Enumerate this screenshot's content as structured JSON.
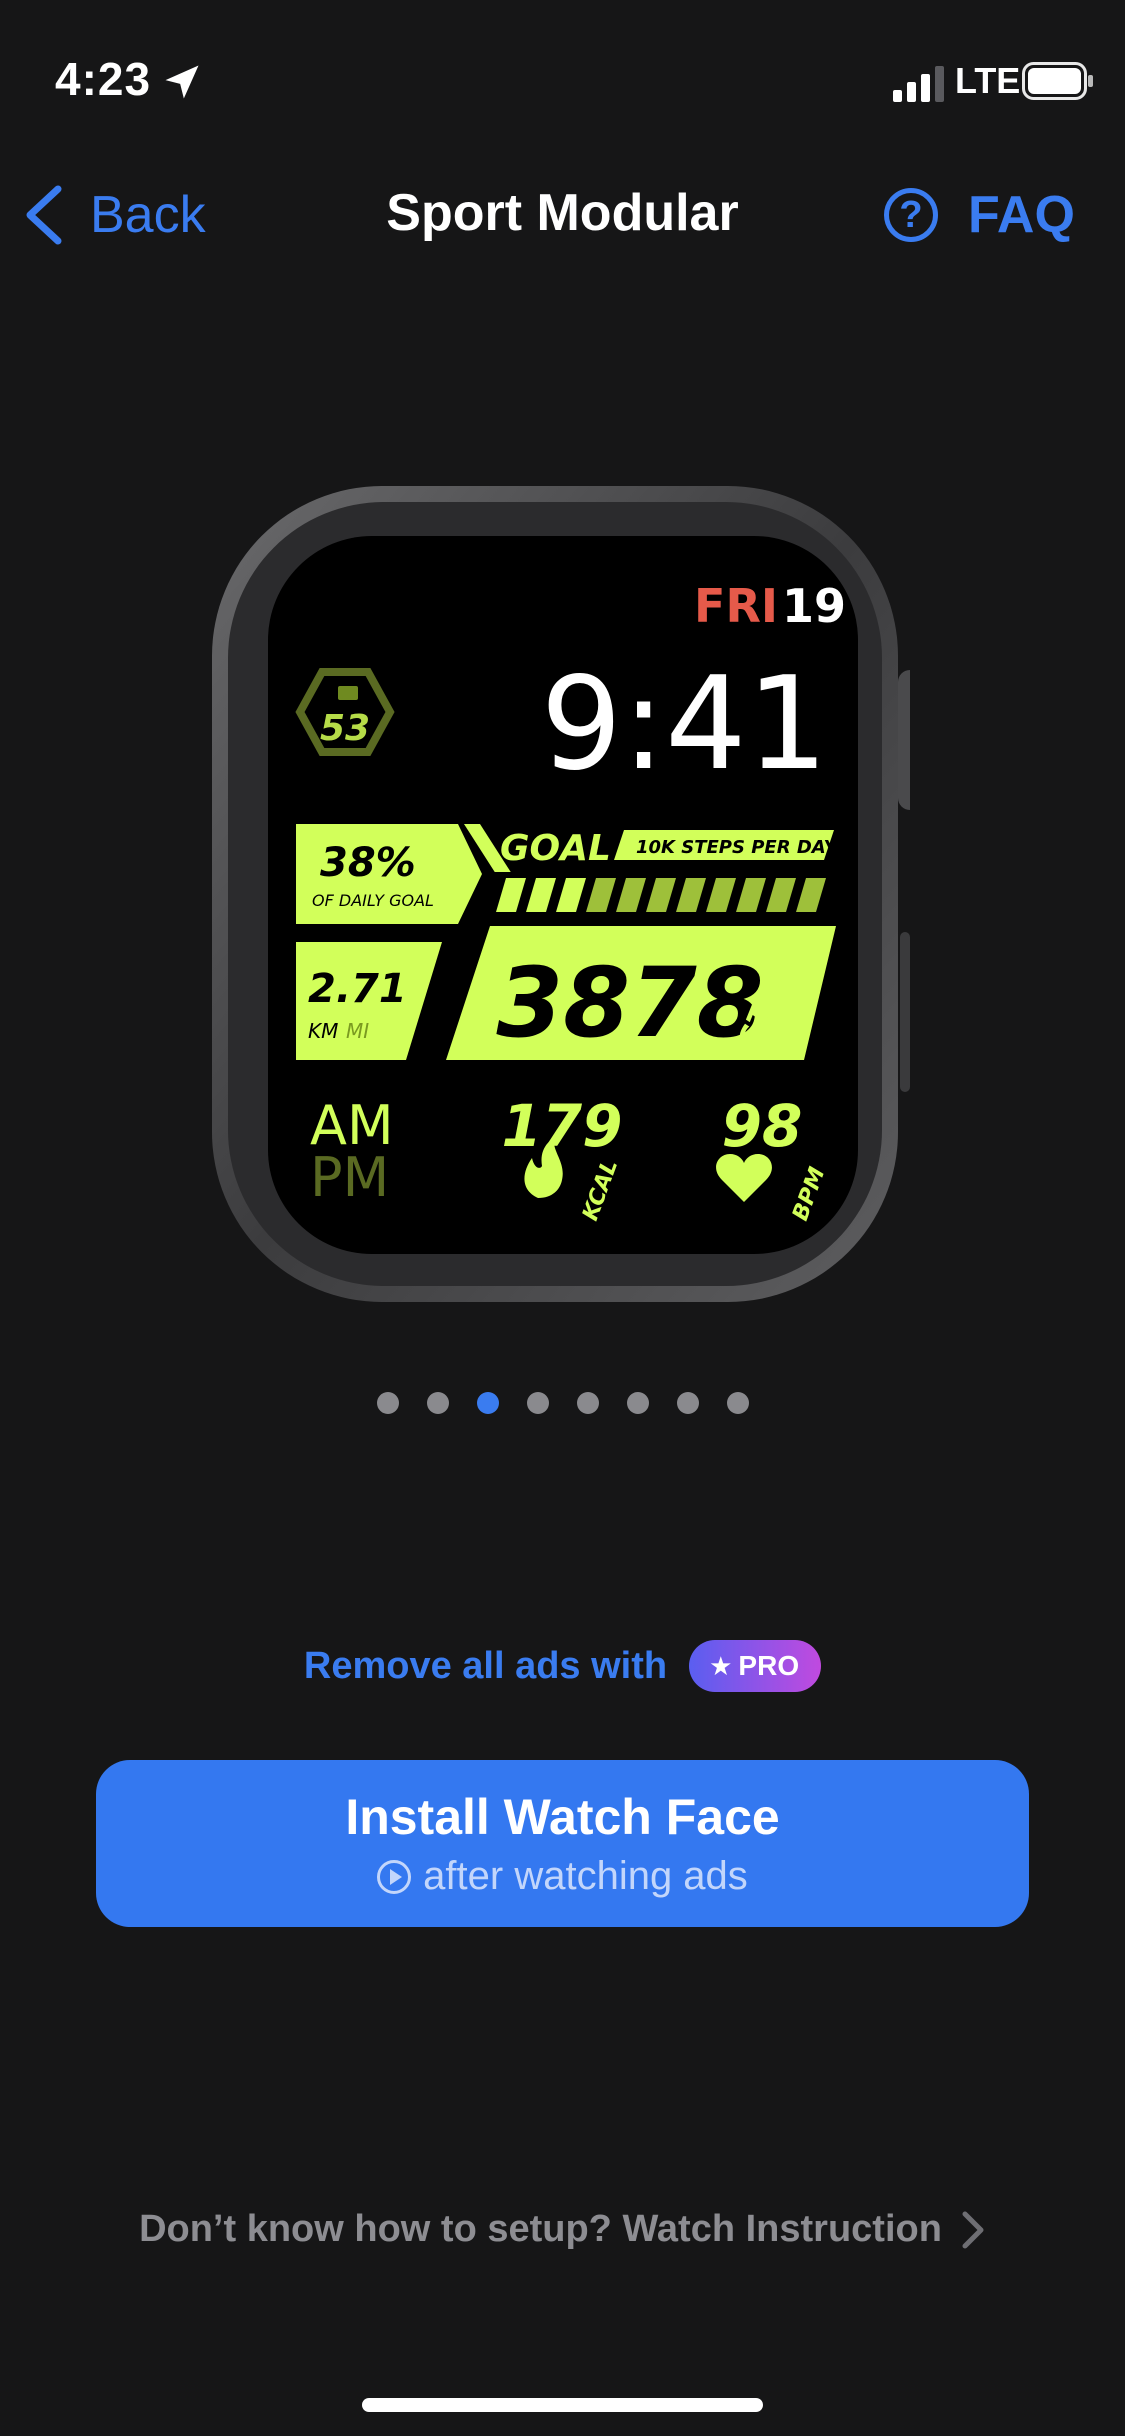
{
  "status": {
    "time": "4:23",
    "network": "LTE"
  },
  "nav": {
    "back_label": "Back",
    "title": "Sport Modular",
    "faq_label": "FAQ"
  },
  "watch_face": {
    "day": "FRI",
    "date": "19",
    "time": "9:41",
    "battery": "53",
    "goal_label": "GOAL",
    "goal_target": "10K STEPS PER DAY",
    "daily_percent": "38%",
    "daily_percent_label": "OF DAILY GOAL",
    "distance": "2.71",
    "unit_km": "KM",
    "unit_mi": "MI",
    "steps": "3878",
    "steps_label": "STEPS",
    "am": "AM",
    "pm": "PM",
    "kcal": "179",
    "kcal_label": "KCAL",
    "bpm": "98",
    "bpm_label": "BPM",
    "goal_progress": 0.38
  },
  "pager": {
    "count": 8,
    "active_index": 2
  },
  "promo": {
    "text": "Remove all ads with",
    "badge": "PRO"
  },
  "install": {
    "title": "Install Watch Face",
    "subtitle": "after watching ads"
  },
  "instruction": {
    "text": "Don’t know how to setup? Watch Instruction"
  },
  "colors": {
    "accent": "#3a7cf0",
    "background": "#161617",
    "watch_lime": "#d2ff5a",
    "day_red": "#e65a4a"
  }
}
